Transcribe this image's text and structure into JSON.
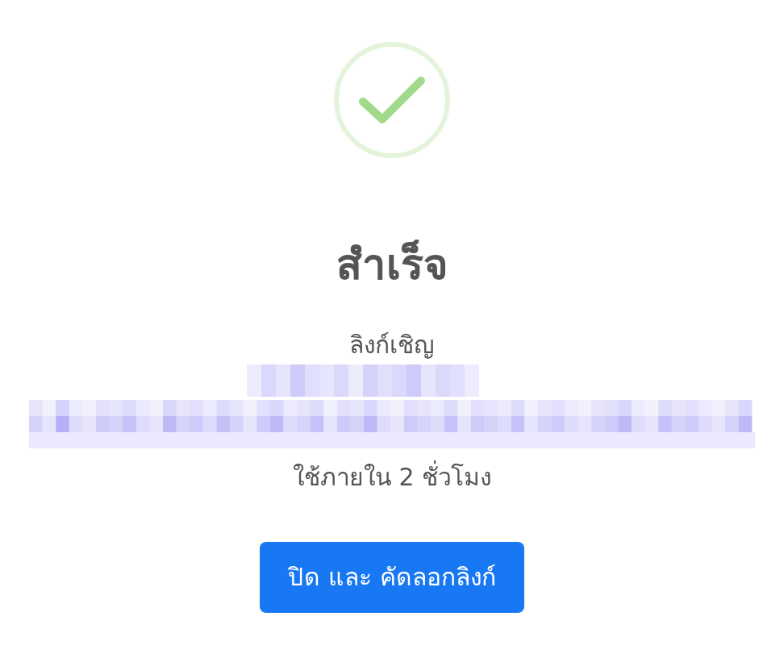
{
  "dialog": {
    "success": true,
    "title": "สำเร็จ",
    "link_label": "ลิงก์เชิญ",
    "expiry": "ใช้ภายใน 2 ชั่วโมง",
    "buttons": [
      "ปิด และ คัดลอกลิงก์"
    ]
  }
}
